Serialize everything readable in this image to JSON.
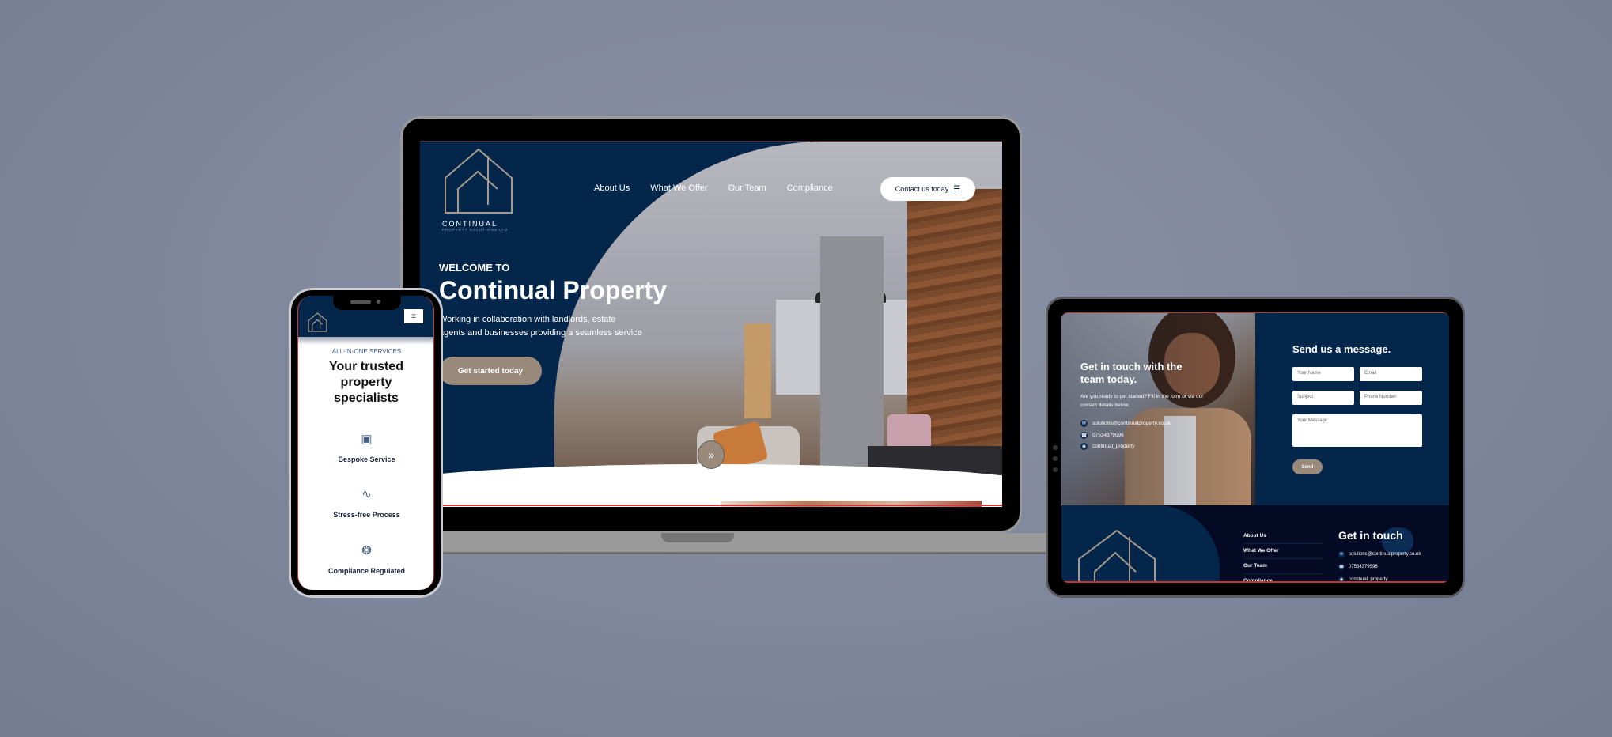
{
  "brand": {
    "name": "CONTINUAL",
    "tagline": "PROPERTY SOLUTIONS LTD",
    "colors": {
      "navy": "#03264a",
      "taupe": "#9a8a7b",
      "footer_dark": "#040a24",
      "accent_red": "#c0392b"
    }
  },
  "laptop": {
    "nav": [
      "About Us",
      "What We Offer",
      "Our Team",
      "Compliance"
    ],
    "contact_button": "Contact us today",
    "contact_button_icon": "hamburger-menu-icon",
    "hero": {
      "kicker": "WELCOME TO",
      "title": "Continual Property",
      "subtitle_line1": "Working in collaboration with landlords, estate",
      "subtitle_line2": "agents and businesses providing a seamless service",
      "cta": "Get started today",
      "scroll_icon": "double-chevron-down-icon"
    }
  },
  "phone": {
    "menu_icon": "hamburger-menu-icon",
    "kicker": "ALL-IN-ONE SERVICES",
    "title": "Your trusted property specialists",
    "features": [
      {
        "icon": "bars-stack-icon",
        "label": "Bespoke Service"
      },
      {
        "icon": "line-chart-icon",
        "label": "Stress-free Process"
      },
      {
        "icon": "award-badge-icon",
        "label": "Compliance Regulated"
      }
    ]
  },
  "tablet": {
    "contact_heading": "Get in touch with the team today.",
    "contact_text": "Are you ready to get started? Fill in the form or via our contact details below.",
    "contacts": [
      {
        "icon": "envelope-icon",
        "value": "solutions@continualproperty.co.uk"
      },
      {
        "icon": "phone-icon",
        "value": "07534379596"
      },
      {
        "icon": "instagram-icon",
        "value": "continual_property"
      }
    ],
    "form": {
      "heading": "Send us a message.",
      "name_placeholder": "Your Name",
      "email_placeholder": "Email",
      "subject_placeholder": "Subject",
      "phone_placeholder": "Phone Number",
      "message_placeholder": "Your Message",
      "send": "Send"
    },
    "footer": {
      "links": [
        "About Us",
        "What We Offer",
        "Our Team",
        "Compliance"
      ],
      "heading": "Get in touch",
      "contacts": [
        {
          "icon": "envelope-icon",
          "value": "solutions@continualproperty.co.uk"
        },
        {
          "icon": "phone-icon",
          "value": "07534379596"
        },
        {
          "icon": "instagram-icon",
          "value": "continual_property"
        }
      ]
    }
  }
}
